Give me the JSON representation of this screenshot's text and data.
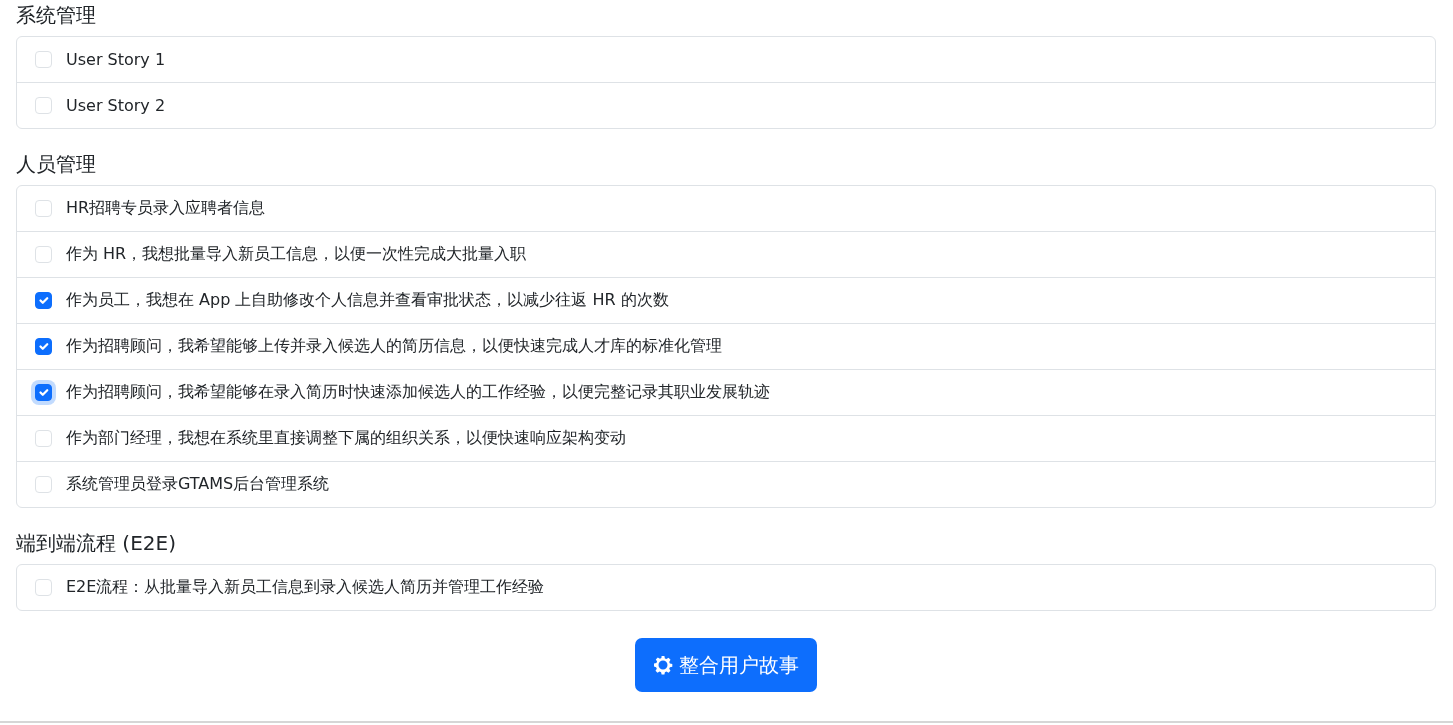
{
  "sections": [
    {
      "title": "系统管理",
      "stories": [
        {
          "label": "User Story 1",
          "checked": false,
          "focused": false
        },
        {
          "label": "User Story 2",
          "checked": false,
          "focused": false
        }
      ]
    },
    {
      "title": "人员管理",
      "stories": [
        {
          "label": "HR招聘专员录入应聘者信息",
          "checked": false,
          "focused": false
        },
        {
          "label": "作为 HR，我想批量导入新员工信息，以便一次性完成大批量入职",
          "checked": false,
          "focused": false
        },
        {
          "label": "作为员工，我想在 App 上自助修改个人信息并查看审批状态，以减少往返 HR 的次数",
          "checked": true,
          "focused": false
        },
        {
          "label": "作为招聘顾问，我希望能够上传并录入候选人的简历信息，以便快速完成人才库的标准化管理",
          "checked": true,
          "focused": false
        },
        {
          "label": "作为招聘顾问，我希望能够在录入简历时快速添加候选人的工作经验，以便完整记录其职业发展轨迹",
          "checked": true,
          "focused": true
        },
        {
          "label": "作为部门经理，我想在系统里直接调整下属的组织关系，以便快速响应架构变动",
          "checked": false,
          "focused": false
        },
        {
          "label": "系统管理员登录GTAMS后台管理系统",
          "checked": false,
          "focused": false
        }
      ]
    },
    {
      "title": "端到端流程 (E2E)",
      "stories": [
        {
          "label": "E2E流程：从批量导入新员工信息到录入候选人简历并管理工作经验",
          "checked": false,
          "focused": false
        }
      ]
    }
  ],
  "merge_button": {
    "label": "整合用户故事"
  }
}
